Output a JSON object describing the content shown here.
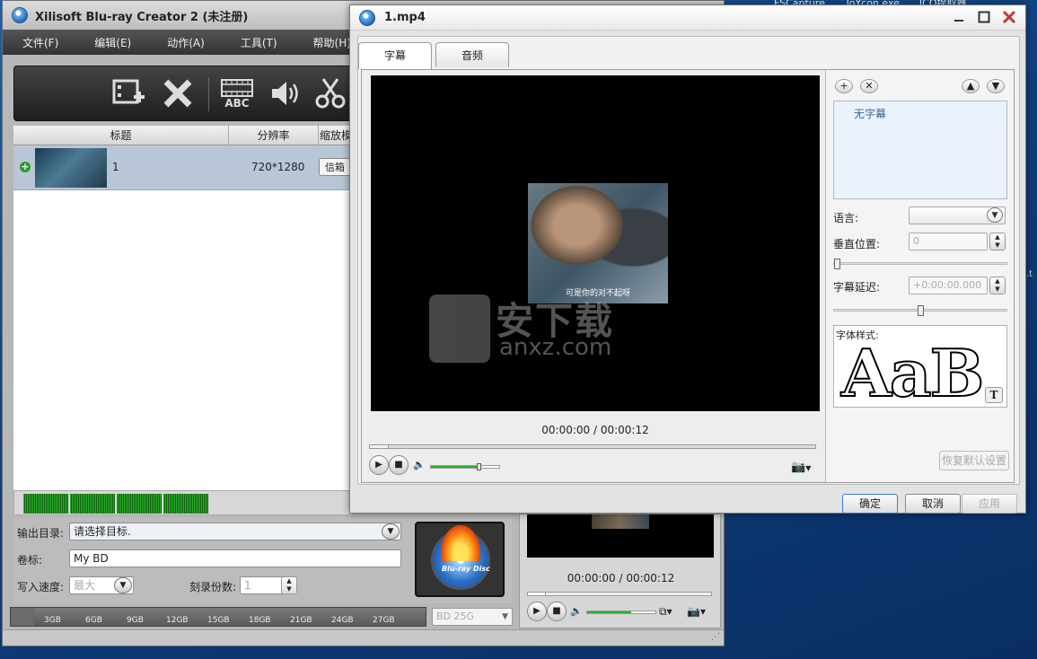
{
  "desktop": {
    "taskbar_items": [
      "FSCapture",
      "ToYcon.exe",
      "ICO提取器"
    ],
    "edge_text": ".t"
  },
  "main": {
    "title": "Xilisoft Blu-ray Creator 2 (未注册)",
    "menu": [
      "文件(F)",
      "编辑(E)",
      "动作(A)",
      "工具(T)",
      "帮助(H)"
    ],
    "toolbar": {
      "abc_label": "ABC"
    },
    "list": {
      "headers": [
        "标题",
        "分辨率",
        "缩放模"
      ],
      "rows": [
        {
          "title": "1",
          "resolution": "720*1280",
          "zoom": "信箱"
        }
      ]
    },
    "output": {
      "dir_label": "输出目录:",
      "dir_value": "请选择目标.",
      "volume_label": "卷标:",
      "volume_value": "My BD",
      "speed_label": "写入速度:",
      "speed_value": "最大",
      "copies_label": "刻录份数:",
      "copies_value": "1"
    },
    "burn_logo_text": "Blu-ray Disc",
    "capacity": {
      "ticks": [
        "3GB",
        "6GB",
        "9GB",
        "12GB",
        "15GB",
        "18GB",
        "21GB",
        "24GB",
        "27GB"
      ],
      "disc_type": "BD 25G"
    },
    "mini_player": {
      "time": "00:00:00 / 00:00:12"
    }
  },
  "dialog": {
    "title": "1.mp4",
    "tabs": [
      "字幕",
      "音频"
    ],
    "video": {
      "subtitle_text": "可是你的对不起呀",
      "watermark_title": "安下载",
      "watermark_sub": "anxz.com"
    },
    "player": {
      "time": "00:00:00 / 00:00:12"
    },
    "subtitle_panel": {
      "list_item": "无字幕",
      "language_label": "语言:",
      "vpos_label": "垂直位置:",
      "vpos_value": "0",
      "delay_label": "字幕延迟:",
      "delay_value": "+0:00:00.000",
      "font_label": "字体样式:",
      "font_sample": "AaB",
      "font_button": "T",
      "reset_label": "恢复默认设置"
    },
    "buttons": {
      "ok": "确定",
      "cancel": "取消",
      "apply": "应用"
    }
  }
}
